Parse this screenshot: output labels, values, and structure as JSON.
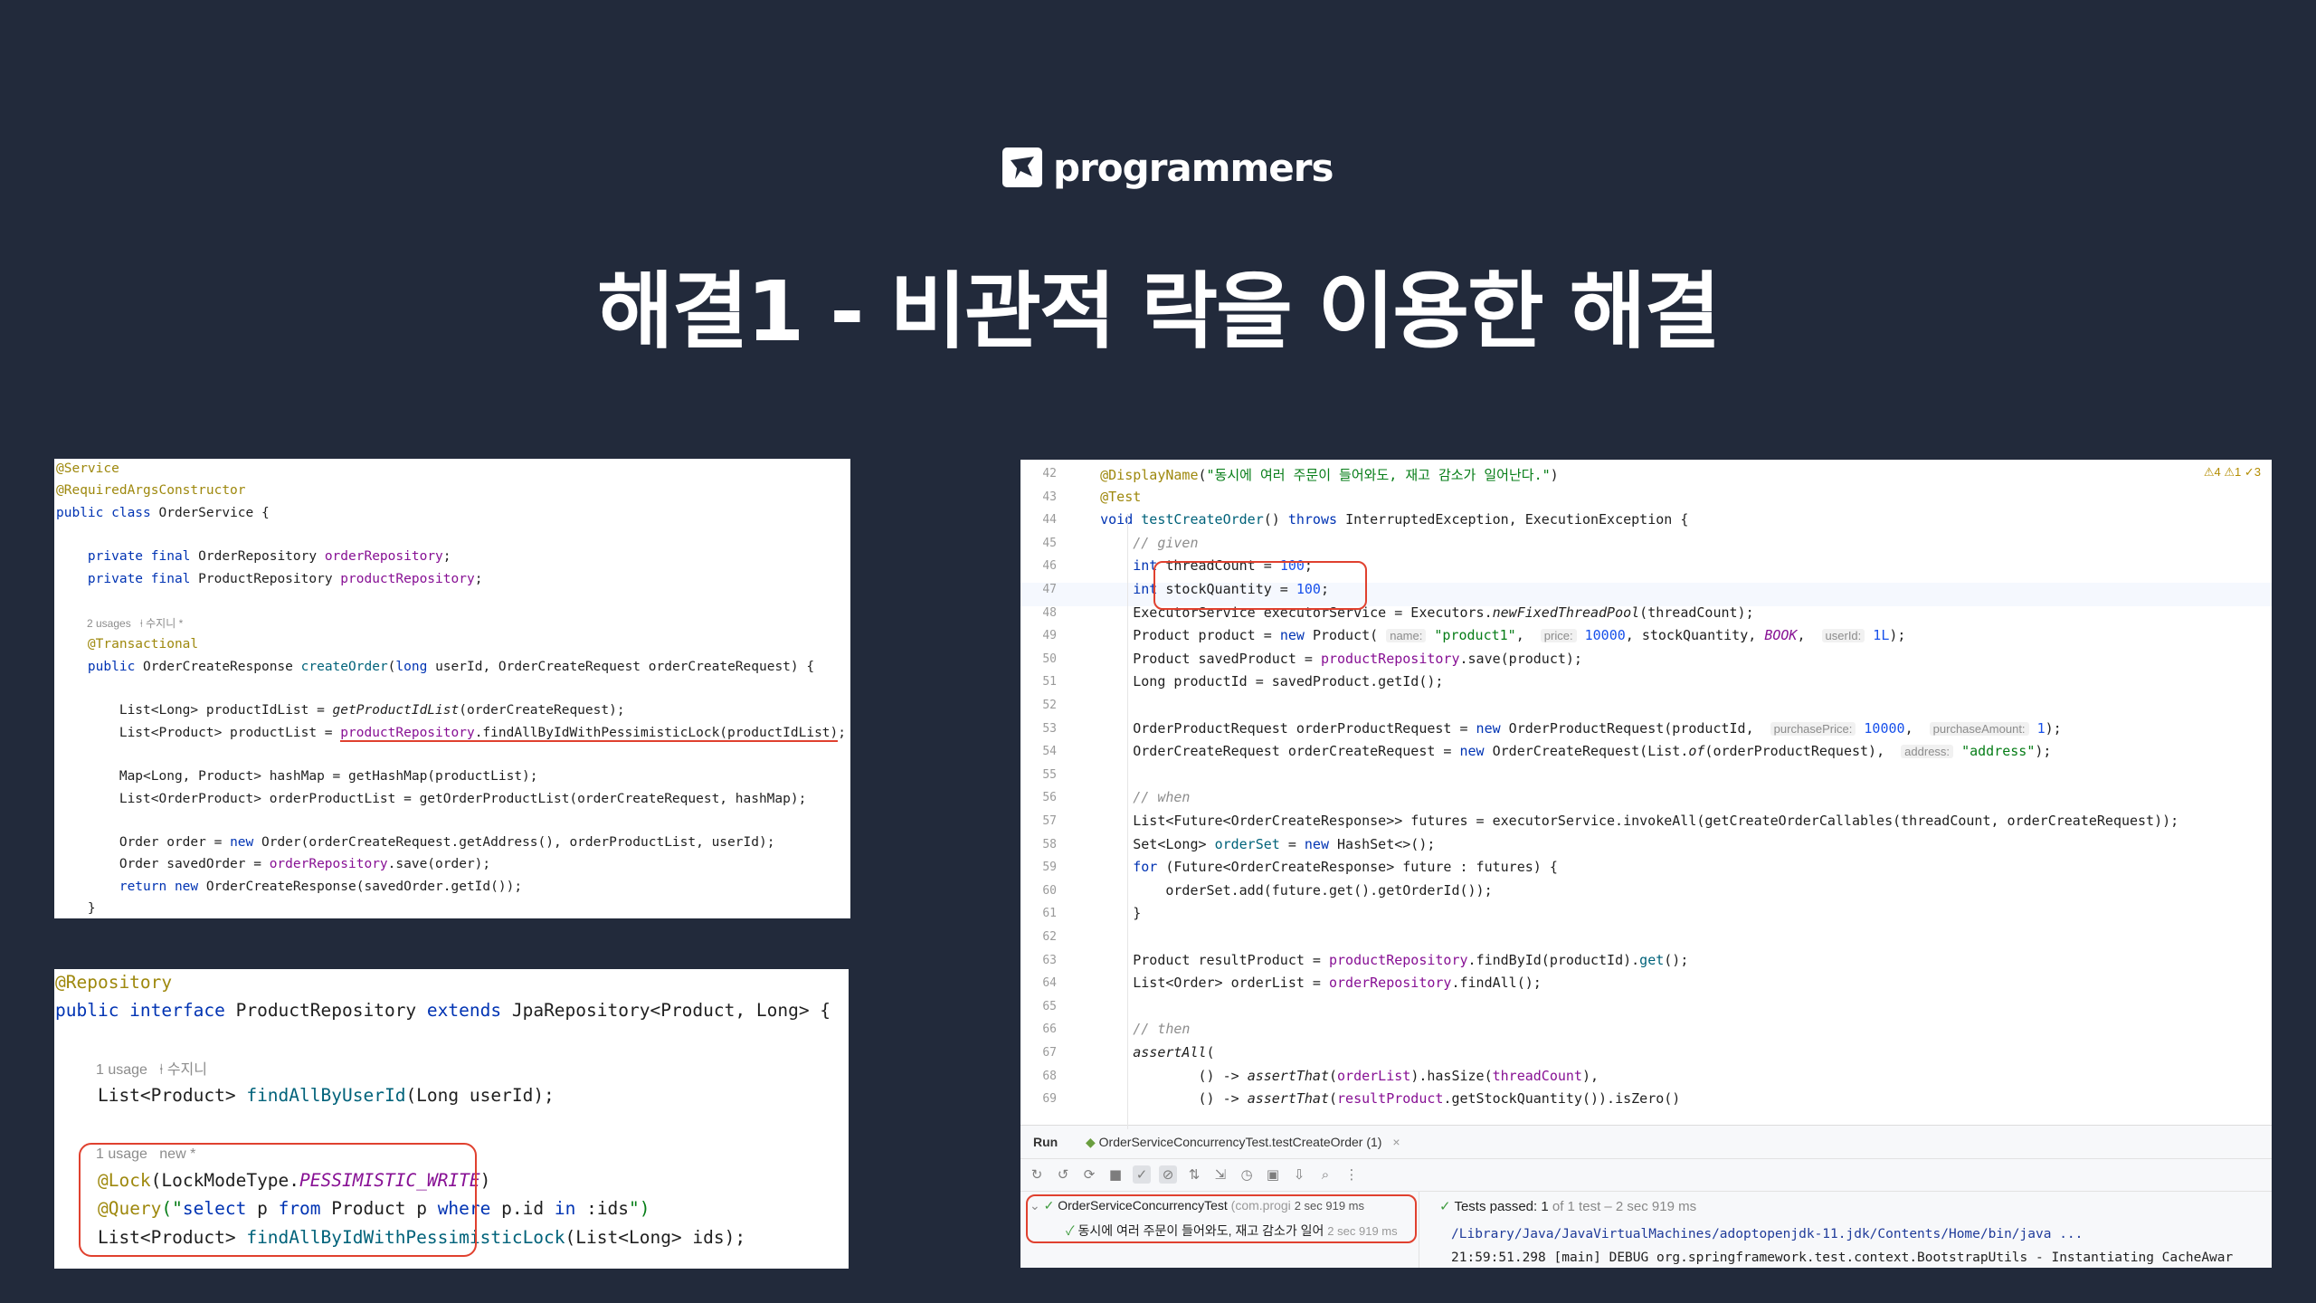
{
  "logo": {
    "text": "programmers"
  },
  "title": "해결1 -  비관적 락을 이용한 해결",
  "panel1": {
    "lines": [
      {
        "t": [
          [
            "ann",
            "@Service"
          ]
        ]
      },
      {
        "t": [
          [
            "ann",
            "@RequiredArgsConstructor"
          ]
        ]
      },
      {
        "t": [
          [
            "kw",
            "public class "
          ],
          [
            "",
            "OrderService {"
          ]
        ]
      },
      {
        "t": []
      },
      {
        "t": [
          [
            "",
            "    "
          ],
          [
            "kw",
            "private final "
          ],
          [
            "",
            "OrderRepository "
          ],
          [
            "fld",
            "orderRepository"
          ],
          [
            "",
            ";"
          ]
        ]
      },
      {
        "t": [
          [
            "",
            "    "
          ],
          [
            "kw",
            "private final "
          ],
          [
            "",
            "ProductRepository "
          ],
          [
            "fld",
            "productRepository"
          ],
          [
            "",
            ";"
          ]
        ]
      },
      {
        "t": []
      },
      {
        "meta": "2 usages   ⍿ 수지니 *"
      },
      {
        "t": [
          [
            "",
            "    "
          ],
          [
            "ann",
            "@Transactional"
          ]
        ]
      },
      {
        "t": [
          [
            "",
            "    "
          ],
          [
            "kw",
            "public "
          ],
          [
            "",
            "OrderCreateResponse "
          ],
          [
            "fn",
            "createOrder"
          ],
          [
            "",
            "("
          ],
          [
            "kw",
            "long "
          ],
          [
            "",
            "userId, OrderCreateRequest orderCreateRequest) {"
          ]
        ]
      },
      {
        "t": []
      },
      {
        "t": [
          [
            "",
            "        List<Long> productIdList = "
          ],
          [
            "ital",
            "getProductIdList"
          ],
          [
            "",
            "(orderCreateRequest);"
          ]
        ]
      },
      {
        "t": [
          [
            "",
            "        List<Product> productList = "
          ],
          [
            "u-fld",
            "productRepository"
          ],
          [
            "u",
            ".findAllByIdWithPessimisticLock(productIdList)"
          ],
          [
            "",
            ";"
          ]
        ]
      },
      {
        "t": []
      },
      {
        "t": [
          [
            "",
            "        Map<Long, Product> hashMap = getHashMap(productList);"
          ]
        ]
      },
      {
        "t": [
          [
            "",
            "        List<OrderProduct> orderProductList = getOrderProductList(orderCreateRequest, hashMap);"
          ]
        ]
      },
      {
        "t": []
      },
      {
        "t": [
          [
            "",
            "        Order order = "
          ],
          [
            "kw",
            "new "
          ],
          [
            "",
            "Order(orderCreateRequest.getAddress(), orderProductList, userId);"
          ]
        ]
      },
      {
        "t": [
          [
            "",
            "        Order savedOrder = "
          ],
          [
            "fld",
            "orderRepository"
          ],
          [
            "",
            ".save(order);"
          ]
        ]
      },
      {
        "t": [
          [
            "",
            "        "
          ],
          [
            "kw",
            "return new "
          ],
          [
            "",
            "OrderCreateResponse(savedOrder.getId());"
          ]
        ]
      },
      {
        "t": [
          [
            "",
            "    }"
          ]
        ]
      }
    ]
  },
  "panel2": {
    "lines": [
      {
        "t": [
          [
            "ann",
            "@Repository"
          ]
        ]
      },
      {
        "t": [
          [
            "kw",
            "public interface "
          ],
          [
            "",
            "ProductRepository "
          ],
          [
            "kw",
            "extends "
          ],
          [
            "",
            "JpaRepository<Product, Long> {"
          ]
        ]
      },
      {
        "t": []
      },
      {
        "meta": "1 usage   ⍿ 수지니"
      },
      {
        "t": [
          [
            "",
            "    List<Product> "
          ],
          [
            "fn",
            "findAllByUserId"
          ],
          [
            "",
            "(Long userId);"
          ]
        ]
      },
      {
        "t": []
      },
      {
        "meta": "1 usage   new *"
      },
      {
        "t": [
          [
            "",
            "    "
          ],
          [
            "ann",
            "@Lock"
          ],
          [
            "",
            "(LockModeType."
          ],
          [
            "fld-i",
            "PESSIMISTIC_WRITE"
          ],
          [
            "",
            ")"
          ]
        ]
      },
      {
        "t": [
          [
            "",
            "    "
          ],
          [
            "ann",
            "@Query"
          ],
          [
            "str",
            "(\""
          ],
          [
            "kw",
            "select "
          ],
          [
            "",
            "p "
          ],
          [
            "kw",
            "from "
          ],
          [
            "",
            "Product p "
          ],
          [
            "kw",
            "where "
          ],
          [
            "",
            "p.id "
          ],
          [
            "kw",
            "in "
          ],
          [
            "",
            ":ids"
          ],
          [
            "str",
            "\")"
          ]
        ]
      },
      {
        "t": [
          [
            "",
            "    List<Product> "
          ],
          [
            "fn",
            "findAllByIdWithPessimisticLock"
          ],
          [
            "",
            "(List<Long> ids);"
          ]
        ]
      }
    ]
  },
  "panel3": {
    "inspections": "⚠4  ⚠1  ✓3",
    "lines": [
      {
        "n": "42",
        "t": [
          [
            "",
            "    "
          ],
          [
            "ann",
            "@DisplayName"
          ],
          [
            "",
            "("
          ],
          [
            "str",
            "\"동시에 여러 주문이 들어와도, 재고 감소가 일어난다.\""
          ],
          [
            "",
            ")"
          ]
        ]
      },
      {
        "n": "43",
        "t": [
          [
            "",
            "    "
          ],
          [
            "ann",
            "@Test"
          ]
        ]
      },
      {
        "n": "44",
        "t": [
          [
            "",
            "    "
          ],
          [
            "kw",
            "void "
          ],
          [
            "fn",
            "testCreateOrder"
          ],
          [
            "",
            "() "
          ],
          [
            "kw",
            "throws "
          ],
          [
            "",
            "InterruptedException, ExecutionException {"
          ]
        ]
      },
      {
        "n": "45",
        "t": [
          [
            "",
            "        "
          ],
          [
            "cmt",
            "// given"
          ]
        ]
      },
      {
        "n": "46",
        "t": [
          [
            "",
            "        "
          ],
          [
            "kw",
            "int "
          ],
          [
            "",
            "threadCount = "
          ],
          [
            "num",
            "100"
          ],
          [
            "",
            ";"
          ]
        ]
      },
      {
        "n": "47",
        "t": [
          [
            "",
            "        "
          ],
          [
            "kw",
            "int "
          ],
          [
            "",
            "stockQuantity = "
          ],
          [
            "num",
            "100"
          ],
          [
            "",
            ";"
          ]
        ]
      },
      {
        "n": "48",
        "t": [
          [
            "",
            "        ExecutorService executorService = Executors."
          ],
          [
            "ital",
            "newFixedThreadPool"
          ],
          [
            "",
            "(threadCount);"
          ]
        ]
      },
      {
        "n": "49",
        "t": [
          [
            "",
            "        Product product = "
          ],
          [
            "kw",
            "new "
          ],
          [
            "",
            "Product( "
          ],
          [
            "hint",
            "name:"
          ],
          [
            "str",
            " \"product1\""
          ],
          [
            "",
            ",  "
          ],
          [
            "hint",
            "price:"
          ],
          [
            "num",
            " 10000"
          ],
          [
            "",
            ", stockQuantity, "
          ],
          [
            "fld-i",
            "BOOK"
          ],
          [
            "",
            ",  "
          ],
          [
            "hint",
            "userId:"
          ],
          [
            "num",
            " 1L"
          ],
          [
            "",
            ");"
          ]
        ]
      },
      {
        "n": "50",
        "t": [
          [
            "",
            "        Product savedProduct = "
          ],
          [
            "fld",
            "productRepository"
          ],
          [
            "",
            ".save(product);"
          ]
        ]
      },
      {
        "n": "51",
        "t": [
          [
            "",
            "        Long productId = savedProduct.getId();"
          ]
        ]
      },
      {
        "n": "52",
        "t": []
      },
      {
        "n": "53",
        "t": [
          [
            "",
            "        OrderProductRequest orderProductRequest = "
          ],
          [
            "kw",
            "new "
          ],
          [
            "",
            "OrderProductRequest(productId,  "
          ],
          [
            "hint",
            "purchasePrice:"
          ],
          [
            "num",
            " 10000"
          ],
          [
            "",
            ",  "
          ],
          [
            "hint",
            "purchaseAmount:"
          ],
          [
            "num",
            " 1"
          ],
          [
            "",
            ");"
          ]
        ]
      },
      {
        "n": "54",
        "t": [
          [
            "",
            "        OrderCreateRequest orderCreateRequest = "
          ],
          [
            "kw",
            "new "
          ],
          [
            "",
            "OrderCreateRequest(List."
          ],
          [
            "ital",
            "of"
          ],
          [
            "",
            "(orderProductRequest),  "
          ],
          [
            "hint",
            "address:"
          ],
          [
            "str",
            " \"address\""
          ],
          [
            "",
            ");"
          ]
        ]
      },
      {
        "n": "55",
        "t": []
      },
      {
        "n": "56",
        "t": [
          [
            "",
            "        "
          ],
          [
            "cmt",
            "// when"
          ]
        ]
      },
      {
        "n": "57",
        "t": [
          [
            "",
            "        List<Future<OrderCreateResponse>> futures = executorService.invokeAll(getCreateOrderCallables(threadCount, orderCreateRequest));"
          ]
        ]
      },
      {
        "n": "58",
        "t": [
          [
            "",
            "        Set<Long> "
          ],
          [
            "fn",
            "orderSet"
          ],
          [
            "",
            " = "
          ],
          [
            "kw",
            "new "
          ],
          [
            "",
            "HashSet<>();"
          ]
        ]
      },
      {
        "n": "59",
        "t": [
          [
            "",
            "        "
          ],
          [
            "kw",
            "for "
          ],
          [
            "",
            "(Future<OrderCreateResponse> future : futures) {"
          ]
        ]
      },
      {
        "n": "60",
        "t": [
          [
            "",
            "            orderSet.add(future.get().getOrderId());"
          ]
        ]
      },
      {
        "n": "61",
        "t": [
          [
            "",
            "        }"
          ]
        ]
      },
      {
        "n": "62",
        "t": []
      },
      {
        "n": "63",
        "t": [
          [
            "",
            "        Product resultProduct = "
          ],
          [
            "fld",
            "productRepository"
          ],
          [
            "",
            ".findById(productId)."
          ],
          [
            "fn",
            "get"
          ],
          [
            "",
            "();"
          ]
        ]
      },
      {
        "n": "64",
        "t": [
          [
            "",
            "        List<Order> orderList = "
          ],
          [
            "fld",
            "orderRepository"
          ],
          [
            "",
            ".findAll();"
          ]
        ]
      },
      {
        "n": "65",
        "t": []
      },
      {
        "n": "66",
        "t": [
          [
            "",
            "        "
          ],
          [
            "cmt",
            "// then"
          ]
        ]
      },
      {
        "n": "67",
        "t": [
          [
            "",
            "        "
          ],
          [
            "ital",
            "assertAll"
          ],
          [
            "",
            "("
          ]
        ]
      },
      {
        "n": "68",
        "t": [
          [
            "",
            "                () -> "
          ],
          [
            "ital",
            "assertThat"
          ],
          [
            "",
            "("
          ],
          [
            "fld",
            "orderList"
          ],
          [
            "",
            ").hasSize("
          ],
          [
            "fld",
            "threadCount"
          ],
          [
            "",
            "),"
          ]
        ]
      },
      {
        "n": "69",
        "t": [
          [
            "",
            "                () -> "
          ],
          [
            "ital",
            "assertThat"
          ],
          [
            "",
            "("
          ],
          [
            "fld",
            "resultProduct"
          ],
          [
            "",
            ".getStockQuantity()).isZero()"
          ]
        ]
      }
    ],
    "run": {
      "tab_label": "Run",
      "config_label": "OrderServiceConcurrencyTest.testCreateOrder (1)",
      "tree_root": "OrderServiceConcurrencyTest",
      "tree_root_pkg": "(com.progi",
      "tree_root_time": "2 sec 919 ms",
      "tree_child": "동시에 여러 주문이 들어와도, 재고 감소가 일어",
      "tree_child_time": "2 sec 919 ms",
      "status_label": "Tests passed: 1",
      "status_detail": "of 1 test – 2 sec 919 ms",
      "console_line1": "/Library/Java/JavaVirtualMachines/adoptopenjdk-11.jdk/Contents/Home/bin/java ...",
      "console_line2": "21:59:51.298 [main] DEBUG org.springframework.test.context.BootstrapUtils - Instantiating CacheAwar"
    }
  }
}
